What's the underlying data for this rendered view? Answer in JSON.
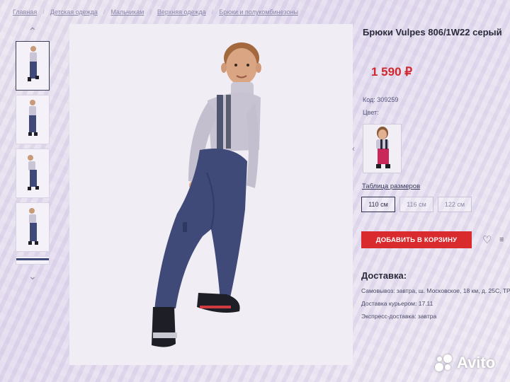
{
  "breadcrumb": [
    "Главная",
    "Детская одежда",
    "Мальчикам",
    "Верхняя одежда",
    "Брюки и полукомбинезоны"
  ],
  "product": {
    "title": "Брюки Vulpes 806/1W22 серый",
    "price": "1 590 ₽",
    "code": "Код: 309259",
    "color_label": "Цвет:",
    "size_table_link": "Таблица размеров",
    "sizes": [
      "110 см",
      "116 см",
      "122 см"
    ],
    "selected_size": "110 см",
    "add_to_cart": "ДОБАВИТЬ В КОРЗИНУ"
  },
  "delivery": {
    "title": "Доставка:",
    "pickup": "Самовывоз: завтра, ш. Московское, 18 км, д. 25С, ТР",
    "courier": "Доставка курьером: 17.11",
    "express": "Экспресс-доставка: завтра"
  },
  "icons": {
    "thumb_up": "chevron-up-icon",
    "thumb_down": "chevron-down-icon",
    "color_prev": "chevron-left-icon",
    "favorite": "heart-icon"
  },
  "colors": {
    "accent": "#d92a2e",
    "price": "#d0282e",
    "pants": "#3f4a78",
    "sweater": "#c9c5d6"
  },
  "watermark": "Avito"
}
